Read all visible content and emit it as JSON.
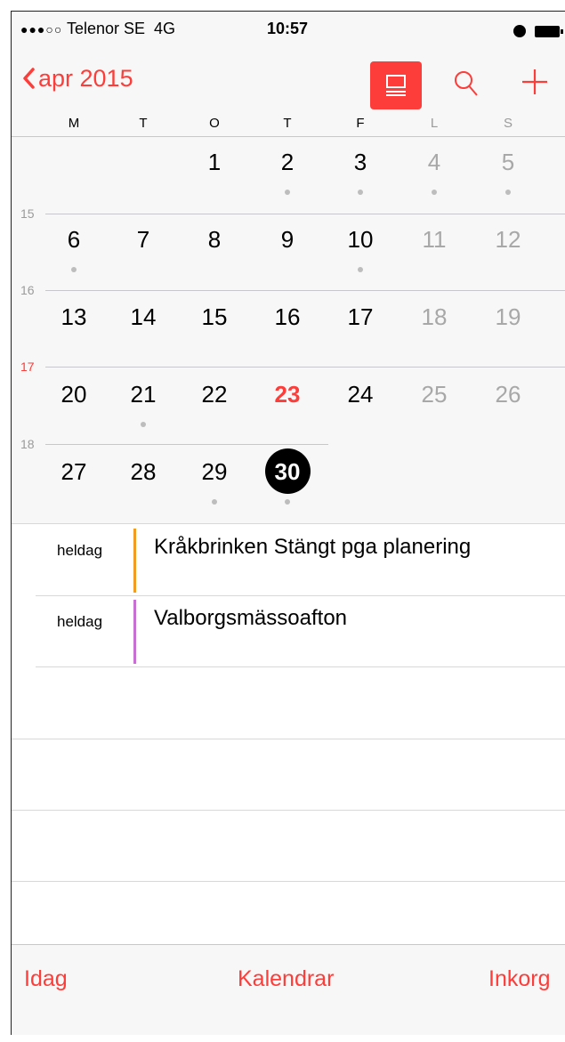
{
  "status_bar": {
    "signal": "●●●○○",
    "carrier": "Telenor SE",
    "network": "4G",
    "time": "10:57"
  },
  "nav": {
    "back_label": "apr 2015"
  },
  "weekdays": [
    "M",
    "T",
    "O",
    "T",
    "F",
    "L",
    "S"
  ],
  "weeks": [
    {
      "number": "",
      "days": [
        "",
        "",
        "1",
        "2",
        "3",
        "4",
        "5"
      ]
    },
    {
      "number": "15",
      "days": [
        "6",
        "7",
        "8",
        "9",
        "10",
        "11",
        "12"
      ]
    },
    {
      "number": "16",
      "days": [
        "13",
        "14",
        "15",
        "16",
        "17",
        "18",
        "19"
      ]
    },
    {
      "number": "17",
      "days": [
        "20",
        "21",
        "22",
        "23",
        "24",
        "25",
        "26"
      ]
    },
    {
      "number": "18",
      "days": [
        "27",
        "28",
        "29",
        "30",
        "",
        "",
        ""
      ]
    }
  ],
  "today": "23",
  "selected_day": "30",
  "current_week": "17",
  "days_with_events": [
    "2",
    "3",
    "4",
    "5",
    "6",
    "10",
    "21",
    "29",
    "30"
  ],
  "events": [
    {
      "time": "heldag",
      "title": "Kråkbrinken Stängt pga planering",
      "color": "#f19d24"
    },
    {
      "time": "heldag",
      "title": "Valborgsmässoafton",
      "color": "#c86fd3"
    }
  ],
  "tabs": {
    "today": "Idag",
    "calendars": "Kalendrar",
    "inbox": "Inkorg"
  },
  "colors": {
    "accent": "#fc3d39",
    "event_dot": "#bdbdbd"
  },
  "icons": [
    "chevron-left-icon",
    "list-view-icon",
    "search-icon",
    "plus-icon",
    "alarm-icon",
    "battery-icon"
  ]
}
